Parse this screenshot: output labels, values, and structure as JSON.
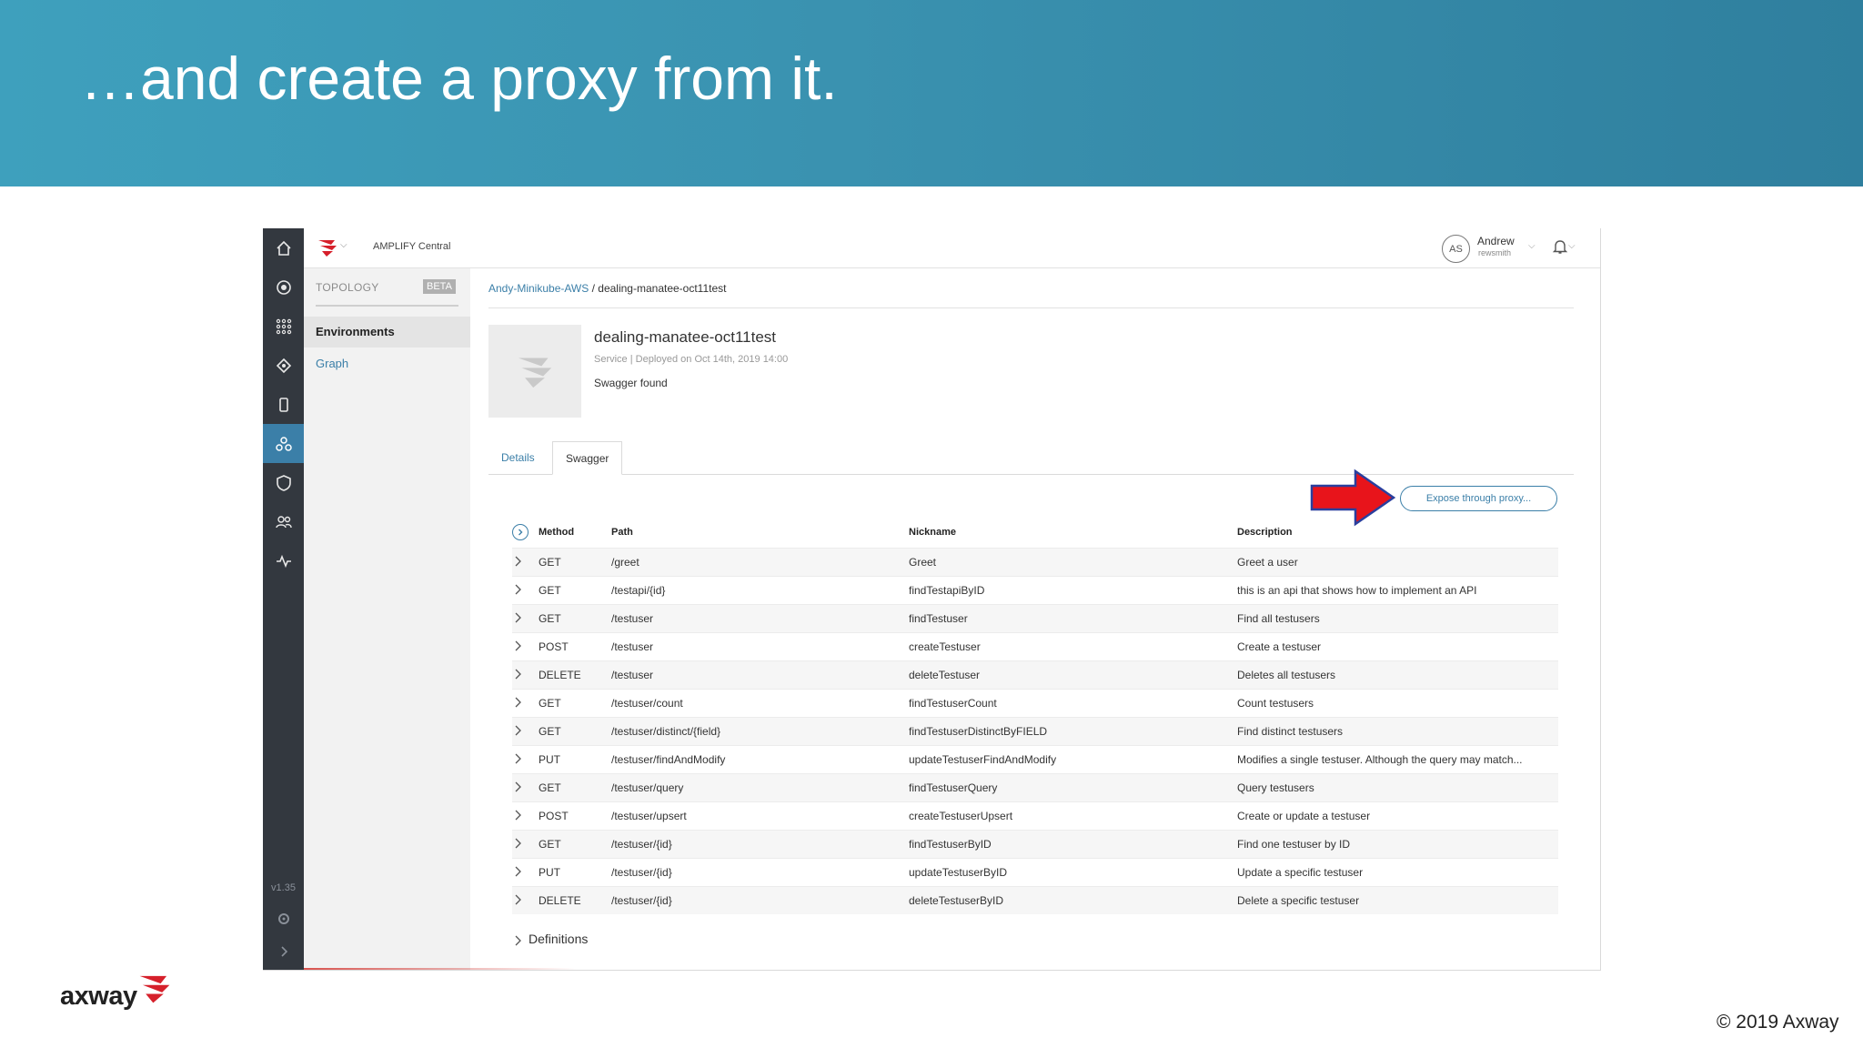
{
  "slide": {
    "title": "…and create a proxy from it.",
    "copyright": "© 2019 Axway",
    "footer_brand": "axway",
    "band_color": "#3a92b0"
  },
  "app": {
    "product_name": "AMPLIFY Central",
    "version": "v1.35",
    "rail_icons": [
      "home-icon",
      "target-icon",
      "apps-grid-icon",
      "hub-icon",
      "mobile-icon",
      "topology-icon",
      "shield-icon",
      "users-icon",
      "activity-icon"
    ],
    "user": {
      "initials": "AS",
      "name": "Andrew",
      "username": "rewsmith"
    }
  },
  "subnav": {
    "header": "TOPOLOGY",
    "badge": "BETA",
    "items": [
      {
        "label": "Environments"
      },
      {
        "label": "Graph"
      }
    ]
  },
  "breadcrumb": {
    "parent": "Andy-Minikube-AWS",
    "separator": " / ",
    "current": "dealing-manatee-oct11test"
  },
  "service": {
    "name": "dealing-manatee-oct11test",
    "meta": "Service  |  Deployed on Oct 14th, 2019 14:00",
    "status": "Swagger found"
  },
  "tabs": {
    "details": "Details",
    "swagger": "Swagger"
  },
  "actions": {
    "expose": "Expose through proxy..."
  },
  "table": {
    "headers": {
      "method": "Method",
      "path": "Path",
      "nickname": "Nickname",
      "description": "Description"
    },
    "rows": [
      {
        "method": "GET",
        "path": "/greet",
        "nickname": "Greet",
        "description": "Greet a user"
      },
      {
        "method": "GET",
        "path": "/testapi/{id}",
        "nickname": "findTestapiByID",
        "description": "this is an api that shows how to implement an API"
      },
      {
        "method": "GET",
        "path": "/testuser",
        "nickname": "findTestuser",
        "description": "Find all testusers"
      },
      {
        "method": "POST",
        "path": "/testuser",
        "nickname": "createTestuser",
        "description": "Create a testuser"
      },
      {
        "method": "DELETE",
        "path": "/testuser",
        "nickname": "deleteTestuser",
        "description": "Deletes all testusers"
      },
      {
        "method": "GET",
        "path": "/testuser/count",
        "nickname": "findTestuserCount",
        "description": "Count testusers"
      },
      {
        "method": "GET",
        "path": "/testuser/distinct/{field}",
        "nickname": "findTestuserDistinctByFIELD",
        "description": "Find distinct testusers"
      },
      {
        "method": "PUT",
        "path": "/testuser/findAndModify",
        "nickname": "updateTestuserFindAndModify",
        "description": "Modifies a single testuser. Although the query may match..."
      },
      {
        "method": "GET",
        "path": "/testuser/query",
        "nickname": "findTestuserQuery",
        "description": "Query testusers"
      },
      {
        "method": "POST",
        "path": "/testuser/upsert",
        "nickname": "createTestuserUpsert",
        "description": "Create or update a testuser"
      },
      {
        "method": "GET",
        "path": "/testuser/{id}",
        "nickname": "findTestuserByID",
        "description": "Find one testuser by ID"
      },
      {
        "method": "PUT",
        "path": "/testuser/{id}",
        "nickname": "updateTestuserByID",
        "description": "Update a specific testuser"
      },
      {
        "method": "DELETE",
        "path": "/testuser/{id}",
        "nickname": "deleteTestuserByID",
        "description": "Delete a specific testuser"
      }
    ],
    "definitions_label": "Definitions"
  },
  "colors": {
    "accent": "#3b7fa8",
    "rail": "#33383f",
    "arrow": "#e8141b",
    "brand_red": "#d6202b"
  }
}
